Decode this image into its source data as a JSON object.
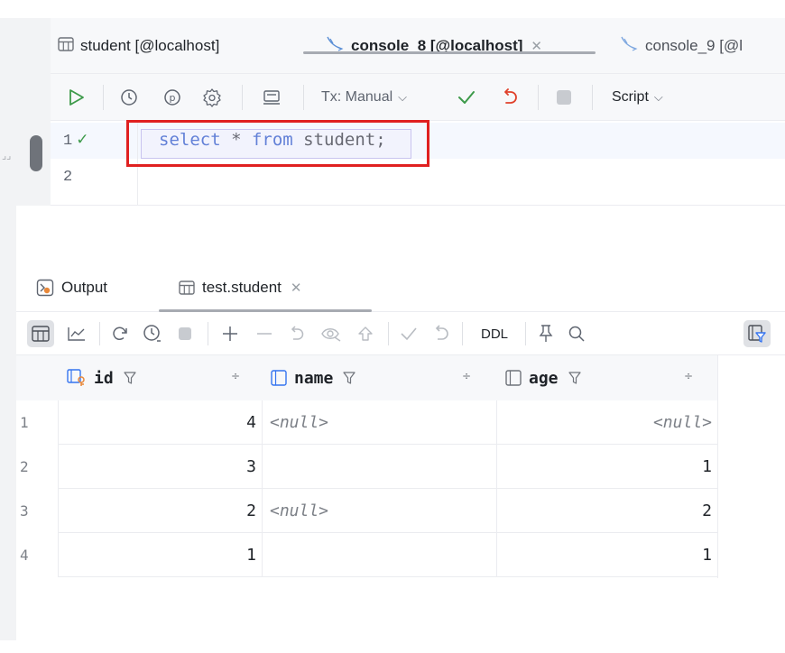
{
  "editor_tabs": [
    {
      "label": "student [@localhost]",
      "icon": "table-icon",
      "active": false
    },
    {
      "label": "console_8 [@localhost]",
      "icon": "console-icon",
      "active": true,
      "closable": true
    },
    {
      "label": "console_9 [@l",
      "icon": "console-icon",
      "active": false
    }
  ],
  "editor_toolbar": {
    "tx_mode": "Tx: Manual",
    "script_label": "Script"
  },
  "editor": {
    "lines": [
      {
        "number": "1",
        "status": "✓"
      },
      {
        "number": "2",
        "status": ""
      }
    ],
    "code": {
      "kw_select": "select",
      "star": " * ",
      "kw_from": "from",
      "rest": " student;"
    }
  },
  "results_tabs": [
    {
      "label": "Output",
      "icon": "output-icon"
    },
    {
      "label": "test.student",
      "icon": "table-icon",
      "closable": true,
      "active": true
    }
  ],
  "results_toolbar": {
    "ddl_label": "DDL"
  },
  "grid": {
    "columns": [
      {
        "name": "id",
        "icon": "primary-key-icon",
        "sort": "÷"
      },
      {
        "name": "name",
        "icon": "column-icon",
        "sort": "÷"
      },
      {
        "name": "age",
        "icon": "column-icon",
        "sort": "÷"
      }
    ],
    "rows": [
      {
        "num": "1",
        "id": "4",
        "name": "<null>",
        "age": "<null>"
      },
      {
        "num": "2",
        "id": "3",
        "name": "",
        "age": "1"
      },
      {
        "num": "3",
        "id": "2",
        "name": "<null>",
        "age": "2"
      },
      {
        "num": "4",
        "id": "1",
        "name": "",
        "age": "1"
      }
    ]
  },
  "colors": {
    "keyword": "#1848c4",
    "highlight_box": "#e02020",
    "success": "#3d9a4a",
    "undo": "#e0402a"
  }
}
